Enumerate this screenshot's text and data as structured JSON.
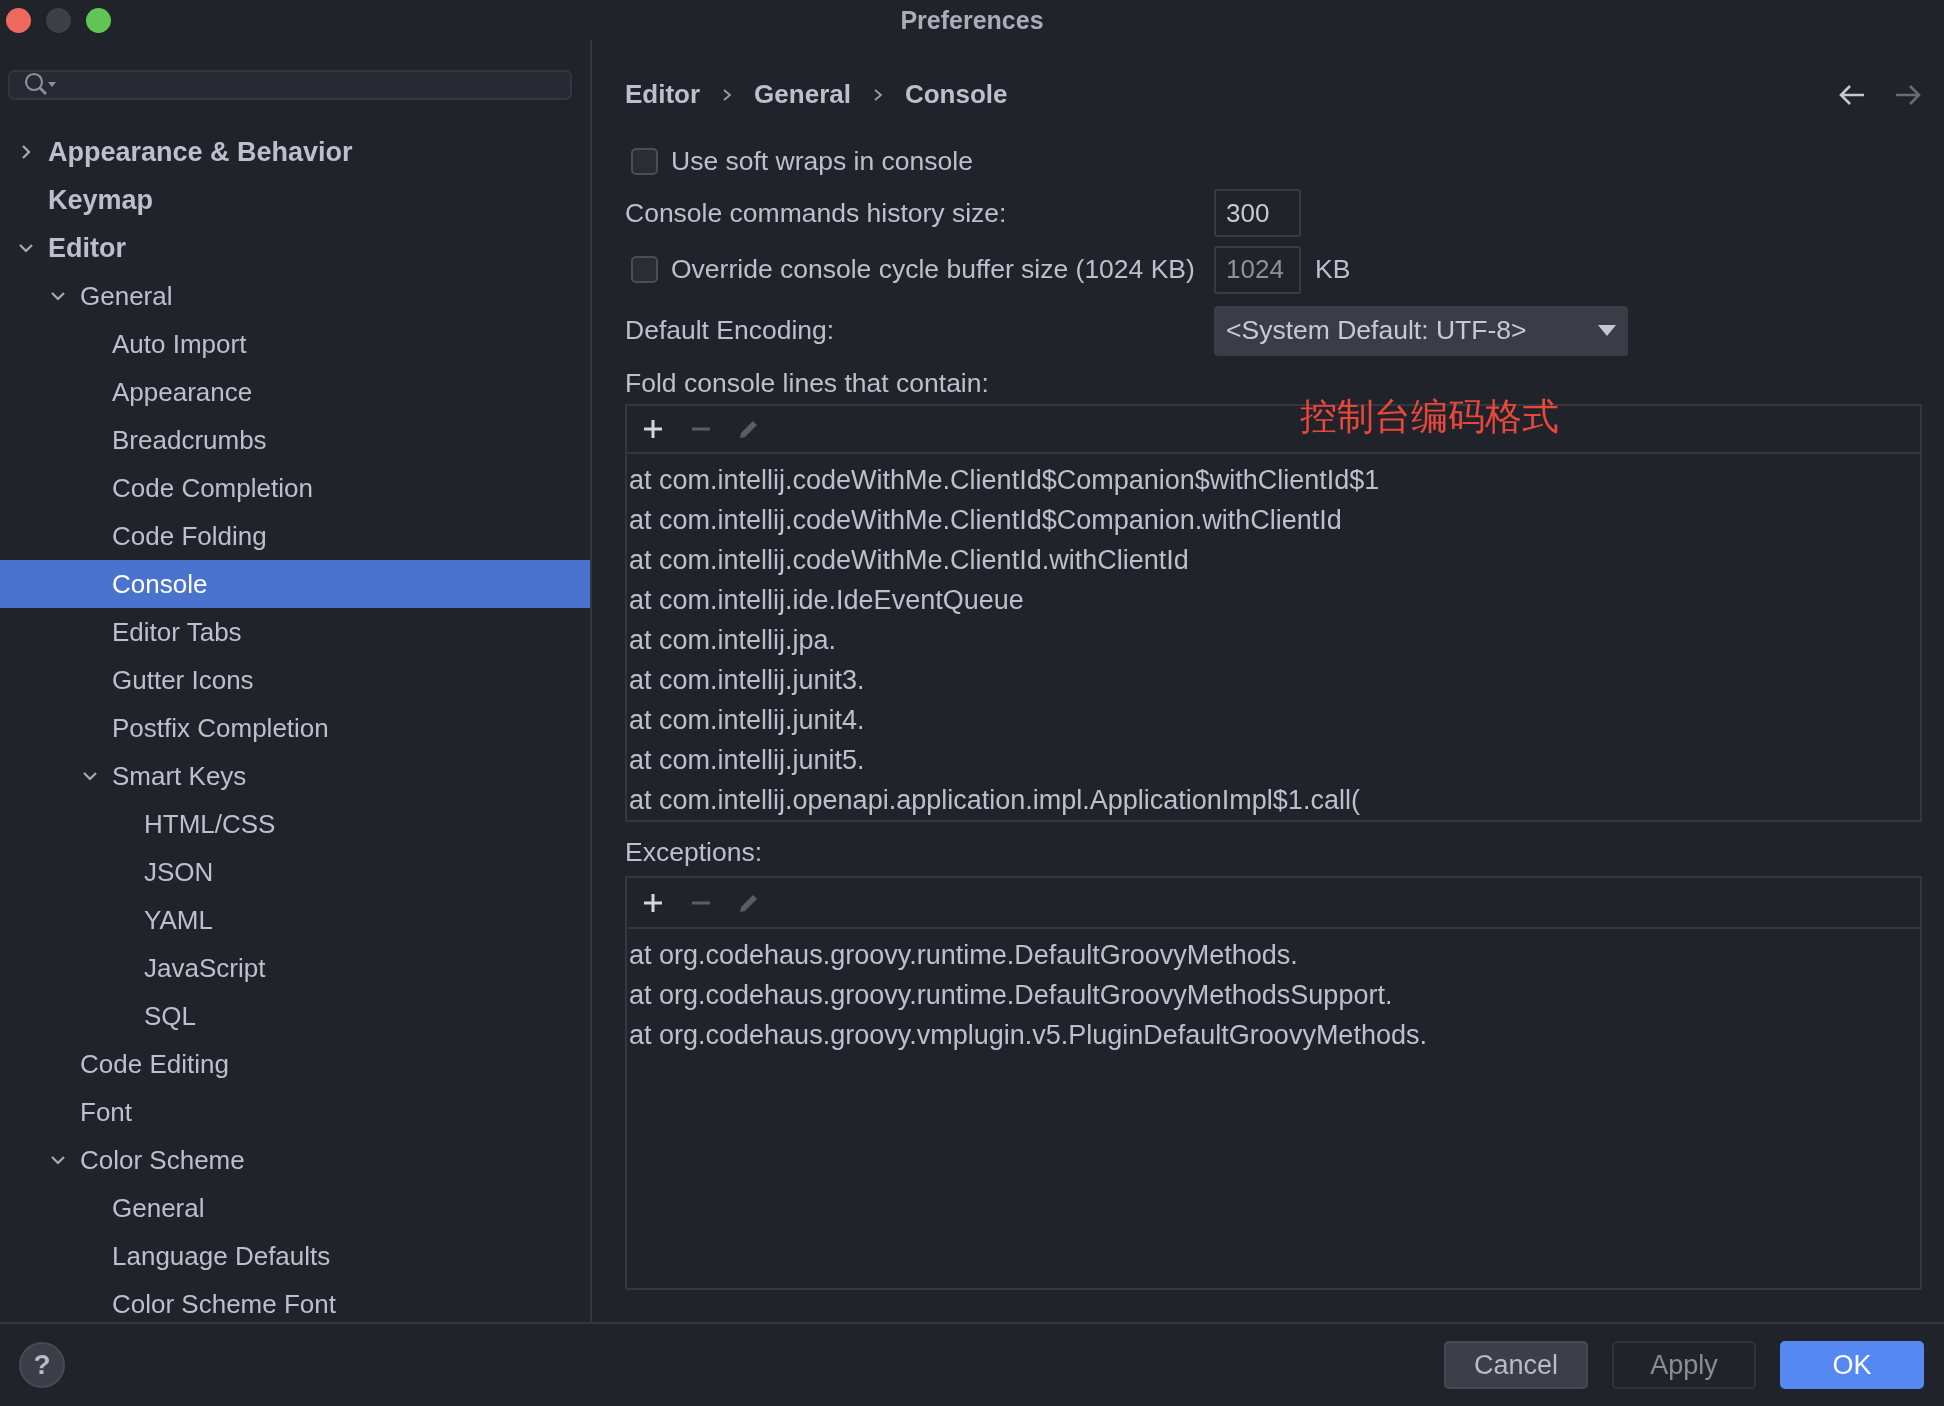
{
  "window": {
    "title": "Preferences"
  },
  "sidebar": {
    "search": {
      "kind": "search"
    },
    "tree": [
      {
        "label": "Appearance & Behavior",
        "selected": false,
        "expanded": false
      },
      {
        "label": "Keymap",
        "selected": false
      },
      {
        "label": "Editor",
        "selected": false,
        "expanded": true,
        "children": [
          {
            "label": "General",
            "selected": false,
            "expanded": true,
            "children": [
              {
                "label": "Auto Import",
                "selected": false
              },
              {
                "label": "Appearance",
                "selected": false
              },
              {
                "label": "Breadcrumbs",
                "selected": false
              },
              {
                "label": "Code Completion",
                "selected": false
              },
              {
                "label": "Code Folding",
                "selected": false
              },
              {
                "label": "Console",
                "selected": true
              },
              {
                "label": "Editor Tabs",
                "selected": false
              },
              {
                "label": "Gutter Icons",
                "selected": false
              },
              {
                "label": "Postfix Completion",
                "selected": false
              },
              {
                "label": "Smart Keys",
                "selected": false,
                "expanded": true,
                "children": [
                  {
                    "label": "HTML/CSS",
                    "selected": false
                  },
                  {
                    "label": "JSON",
                    "selected": false
                  },
                  {
                    "label": "YAML",
                    "selected": false
                  },
                  {
                    "label": "JavaScript",
                    "selected": false
                  },
                  {
                    "label": "SQL",
                    "selected": false
                  }
                ]
              }
            ]
          },
          {
            "label": "Code Editing",
            "selected": false
          },
          {
            "label": "Font",
            "selected": false
          },
          {
            "label": "Color Scheme",
            "selected": false,
            "expanded": true,
            "children": [
              {
                "label": "General",
                "selected": false
              },
              {
                "label": "Language Defaults",
                "selected": false
              },
              {
                "label": "Color Scheme Font",
                "selected": false
              }
            ]
          }
        ]
      }
    ]
  },
  "content": {
    "breadcrumb": [
      "Editor",
      "General",
      "Console"
    ],
    "nav": [
      {
        "kind": "back",
        "disabled": false
      },
      {
        "kind": "forward",
        "disabled": true
      }
    ],
    "soft_wraps": {
      "label": "Use soft wraps in console",
      "checked": false
    },
    "history_size": {
      "label": "Console commands history size:",
      "value": "300"
    },
    "cycle_buffer": {
      "label": "Override console cycle buffer size (1024 KB)",
      "checked": false,
      "value": "1024",
      "disabled": true,
      "unit": "KB"
    },
    "encoding": {
      "label": "Default Encoding:",
      "value": "<System Default: UTF-8>"
    },
    "annotation": "控制台编码格式",
    "fold": {
      "label": "Fold console lines that contain:",
      "toolbar": [
        {
          "kind": "add",
          "disabled": false
        },
        {
          "kind": "remove",
          "disabled": true
        },
        {
          "kind": "edit",
          "disabled": true
        }
      ],
      "lines": [
        "at com.intellij.codeWithMe.ClientId$Companion$withClientId$1",
        "at com.intellij.codeWithMe.ClientId$Companion.withClientId",
        "at com.intellij.codeWithMe.ClientId.withClientId",
        "at com.intellij.ide.IdeEventQueue",
        "at com.intellij.jpa.",
        "at com.intellij.junit3.",
        "at com.intellij.junit4.",
        "at com.intellij.junit5.",
        "at com.intellij.openapi.application.impl.ApplicationImpl$1.call("
      ]
    },
    "exceptions": {
      "label": "Exceptions:",
      "toolbar": [
        {
          "kind": "add",
          "disabled": false
        },
        {
          "kind": "remove",
          "disabled": true
        },
        {
          "kind": "edit",
          "disabled": true
        }
      ],
      "lines": [
        "at org.codehaus.groovy.runtime.DefaultGroovyMethods.",
        "at org.codehaus.groovy.runtime.DefaultGroovyMethodsSupport.",
        "at org.codehaus.groovy.vmplugin.v5.PluginDefaultGroovyMethods."
      ]
    }
  },
  "footer": {
    "help": "?",
    "buttons": [
      {
        "label": "Cancel",
        "kind": "secondary",
        "disabled": false
      },
      {
        "label": "Apply",
        "kind": "secondary",
        "disabled": true
      },
      {
        "label": "OK",
        "kind": "primary",
        "disabled": false
      }
    ]
  }
}
